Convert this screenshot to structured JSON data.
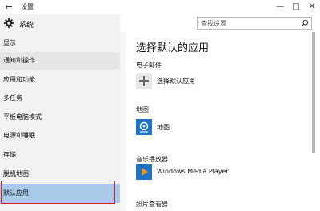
{
  "window": {
    "title": "设置",
    "controls": {
      "minimize": "—",
      "maximize": "□",
      "close": "✕"
    },
    "back_icon": "back-arrow-icon"
  },
  "sidebar": {
    "header": {
      "icon": "gear-icon",
      "title": "系统"
    },
    "items": [
      {
        "label": "显示"
      },
      {
        "label": "通知和操作"
      },
      {
        "label": "应用和功能"
      },
      {
        "label": "多任务"
      },
      {
        "label": "平板电脑模式"
      },
      {
        "label": "电源和睡眠"
      },
      {
        "label": "存储"
      },
      {
        "label": "脱机地图"
      },
      {
        "label": "默认应用"
      }
    ],
    "selected_index": 8
  },
  "search": {
    "placeholder": "查找设置",
    "icon": "search-icon"
  },
  "main": {
    "title": "选择默认的应用",
    "sections": [
      {
        "label": "电子邮件",
        "app_label": "选择默认应用",
        "icon": "plus-icon"
      },
      {
        "label": "地图",
        "app_label": "地图",
        "icon": "maps-icon"
      },
      {
        "label": "音乐播放器",
        "app_label": "Windows Media Player",
        "icon": "media-player-icon"
      },
      {
        "label": "照片查看器"
      }
    ]
  },
  "colors": {
    "selected_bg": "#a9cbe9",
    "highlight_box": "#e21d2c",
    "tile_blue": "#1e73c6"
  }
}
